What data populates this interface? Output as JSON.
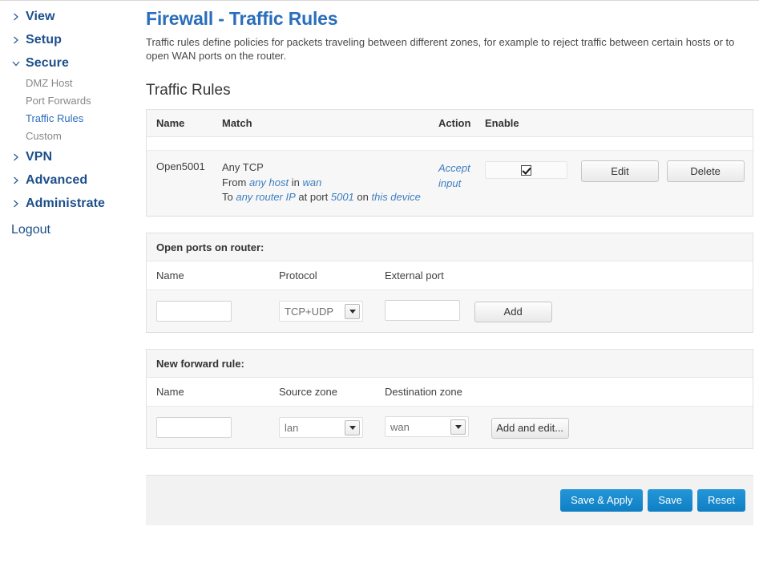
{
  "sidebar": {
    "groups": [
      {
        "label": "View",
        "expanded": false,
        "icon": "chevron-right-icon"
      },
      {
        "label": "Setup",
        "expanded": false,
        "icon": "chevron-right-icon"
      },
      {
        "label": "Secure",
        "expanded": true,
        "icon": "chevron-down-icon"
      },
      {
        "label": "VPN",
        "expanded": false,
        "icon": "chevron-right-icon"
      },
      {
        "label": "Advanced",
        "expanded": false,
        "icon": "chevron-right-icon"
      },
      {
        "label": "Administrate",
        "expanded": false,
        "icon": "chevron-right-icon"
      }
    ],
    "secure_items": [
      {
        "label": "DMZ Host",
        "active": false
      },
      {
        "label": "Port Forwards",
        "active": false
      },
      {
        "label": "Traffic Rules",
        "active": true
      },
      {
        "label": "Custom",
        "active": false
      }
    ],
    "logout_label": "Logout"
  },
  "page": {
    "title": "Firewall - Traffic Rules",
    "description": "Traffic rules define policies for packets traveling between different zones, for example to reject traffic between certain hosts or to open WAN ports on the router.",
    "section_title": "Traffic Rules"
  },
  "rules_table": {
    "headers": {
      "name": "Name",
      "match": "Match",
      "action": "Action",
      "enable": "Enable"
    },
    "rows": [
      {
        "name": "Open5001",
        "match_line1": "Any TCP",
        "match_line2_pre": "From ",
        "match_line2_em1": "any host",
        "match_line2_mid": " in ",
        "match_line2_em2": "wan",
        "match_line3_pre": "To ",
        "match_line3_em1": "any router IP",
        "match_line3_mid1": " at port ",
        "match_line3_em2": "5001",
        "match_line3_mid2": " on ",
        "match_line3_em3": "this device",
        "action_line1": "Accept",
        "action_line2": "input",
        "enabled": true,
        "edit_label": "Edit",
        "delete_label": "Delete"
      }
    ]
  },
  "open_ports": {
    "title": "Open ports on router:",
    "headers": {
      "name": "Name",
      "protocol": "Protocol",
      "external_port": "External port"
    },
    "name_value": "",
    "name_placeholder": "",
    "protocol_value": "TCP+UDP",
    "port_value": "",
    "port_placeholder": "",
    "add_label": "Add"
  },
  "new_forward_rule": {
    "title": "New forward rule:",
    "headers": {
      "name": "Name",
      "source_zone": "Source zone",
      "destination_zone": "Destination zone"
    },
    "name_value": "",
    "name_placeholder": "",
    "source_zone_value": "lan",
    "destination_zone_value": "wan",
    "add_label": "Add and edit..."
  },
  "footer": {
    "save_apply_label": "Save & Apply",
    "save_label": "Save",
    "reset_label": "Reset"
  },
  "colors": {
    "accent_blue": "#2a6ebb",
    "nav_heading": "#1c4f8b",
    "link_italic": "#3d7fc1",
    "button_blue": "#0f7fc4",
    "panel_grey": "#f7f7f7"
  }
}
